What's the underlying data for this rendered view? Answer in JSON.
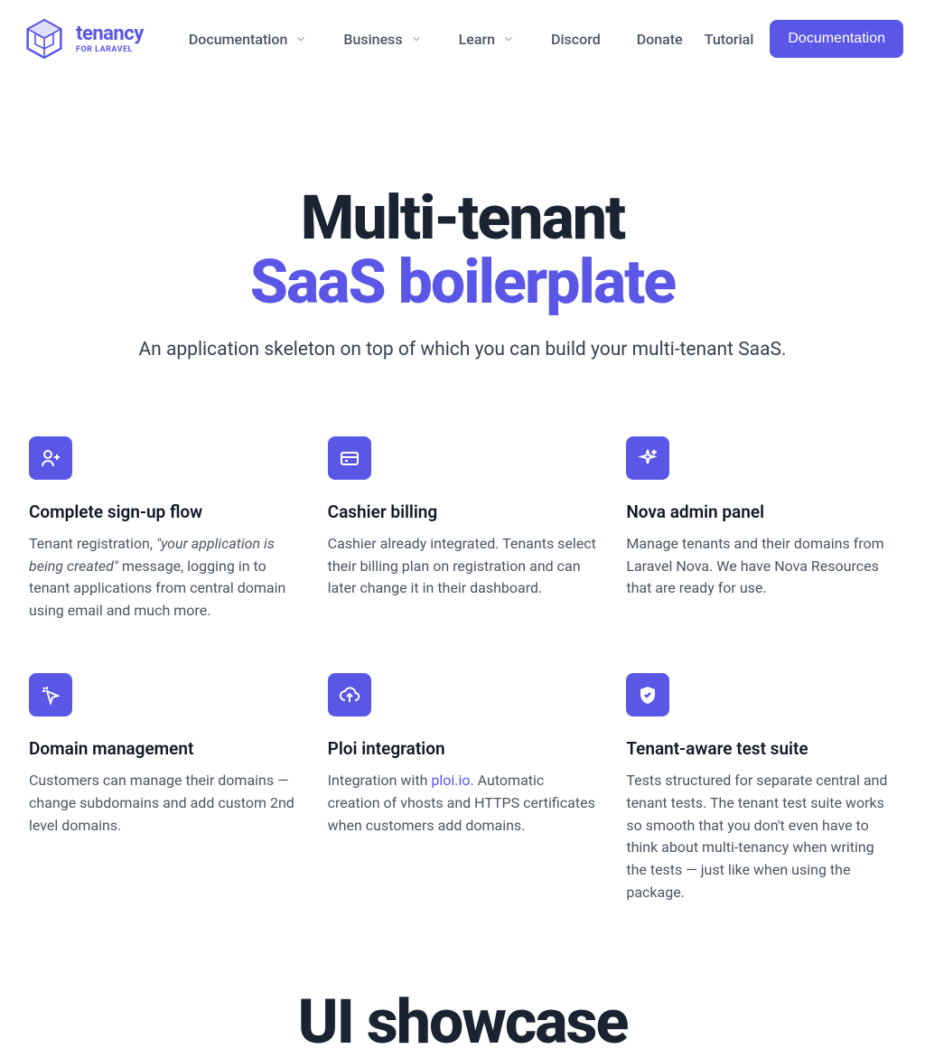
{
  "logo": {
    "title": "tenancy",
    "sub": "FOR LARAVEL"
  },
  "nav": {
    "items": [
      {
        "label": "Documentation",
        "dropdown": true
      },
      {
        "label": "Business",
        "dropdown": true
      },
      {
        "label": "Learn",
        "dropdown": true
      },
      {
        "label": "Discord",
        "dropdown": false
      },
      {
        "label": "Donate",
        "dropdown": false
      }
    ],
    "right": {
      "tutorial": "Tutorial",
      "cta": "Documentation"
    }
  },
  "hero": {
    "line1": "Multi-tenant",
    "line2": "SaaS boilerplate",
    "sub": "An application skeleton on top of which you can build your multi-tenant SaaS."
  },
  "features": [
    {
      "icon": "user-plus-icon",
      "title": "Complete sign-up flow",
      "desc_pre": "Tenant registration, ",
      "desc_em": "\"your application is being created\"",
      "desc_post": " message, logging in to tenant applications from central domain using email and much more."
    },
    {
      "icon": "credit-card-icon",
      "title": "Cashier billing",
      "desc": "Cashier already integrated. Tenants select their billing plan on registration and can later change it in their dashboard."
    },
    {
      "icon": "sparkles-icon",
      "title": "Nova admin panel",
      "desc": "Manage tenants and their domains from Laravel Nova. We have Nova Resources that are ready for use."
    },
    {
      "icon": "cursor-click-icon",
      "title": "Domain management",
      "desc": "Customers can manage their domains — change subdomains and add custom 2nd level domains."
    },
    {
      "icon": "cloud-upload-icon",
      "title": "Ploi integration",
      "desc_pre": "Integration with ",
      "link_text": "ploi.io",
      "desc_post": ". Automatic creation of vhosts and HTTPS certificates when customers add domains."
    },
    {
      "icon": "shield-check-icon",
      "title": "Tenant-aware test suite",
      "desc": "Tests structured for separate central and tenant tests. The tenant test suite works so smooth that you don't even have to think about multi-tenancy when writing the tests — just like when using the package."
    }
  ],
  "showcase": {
    "title": "UI showcase"
  }
}
